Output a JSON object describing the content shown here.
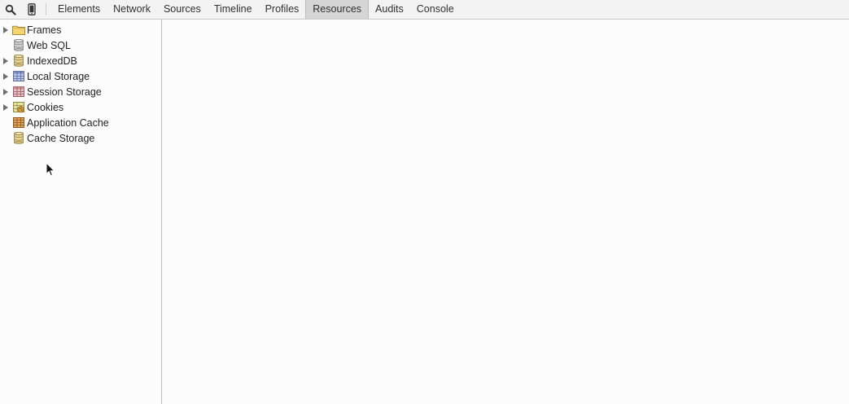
{
  "toolbar": {
    "search_icon": "search-icon",
    "device_icon": "device-mode-icon",
    "tabs": [
      {
        "label": "Elements"
      },
      {
        "label": "Network"
      },
      {
        "label": "Sources"
      },
      {
        "label": "Timeline"
      },
      {
        "label": "Profiles"
      },
      {
        "label": "Resources",
        "selected": true
      },
      {
        "label": "Audits"
      },
      {
        "label": "Console"
      }
    ]
  },
  "sidebar": {
    "items": [
      {
        "label": "Frames",
        "icon": "folder-icon",
        "expandable": true
      },
      {
        "label": "Web SQL",
        "icon": "database-icon",
        "expandable": false
      },
      {
        "label": "IndexedDB",
        "icon": "database-icon",
        "expandable": true
      },
      {
        "label": "Local Storage",
        "icon": "storage-grid-icon",
        "expandable": true
      },
      {
        "label": "Session Storage",
        "icon": "session-storage-icon",
        "expandable": true
      },
      {
        "label": "Cookies",
        "icon": "cookie-icon",
        "expandable": true
      },
      {
        "label": "Application Cache",
        "icon": "application-cache-icon",
        "expandable": false
      },
      {
        "label": "Cache Storage",
        "icon": "database-icon",
        "expandable": false
      }
    ]
  },
  "colors": {
    "toolbar_bg": "#f3f3f3",
    "selected_tab_bg": "#d5d5d5",
    "panel_bg": "#fcfcfc"
  }
}
